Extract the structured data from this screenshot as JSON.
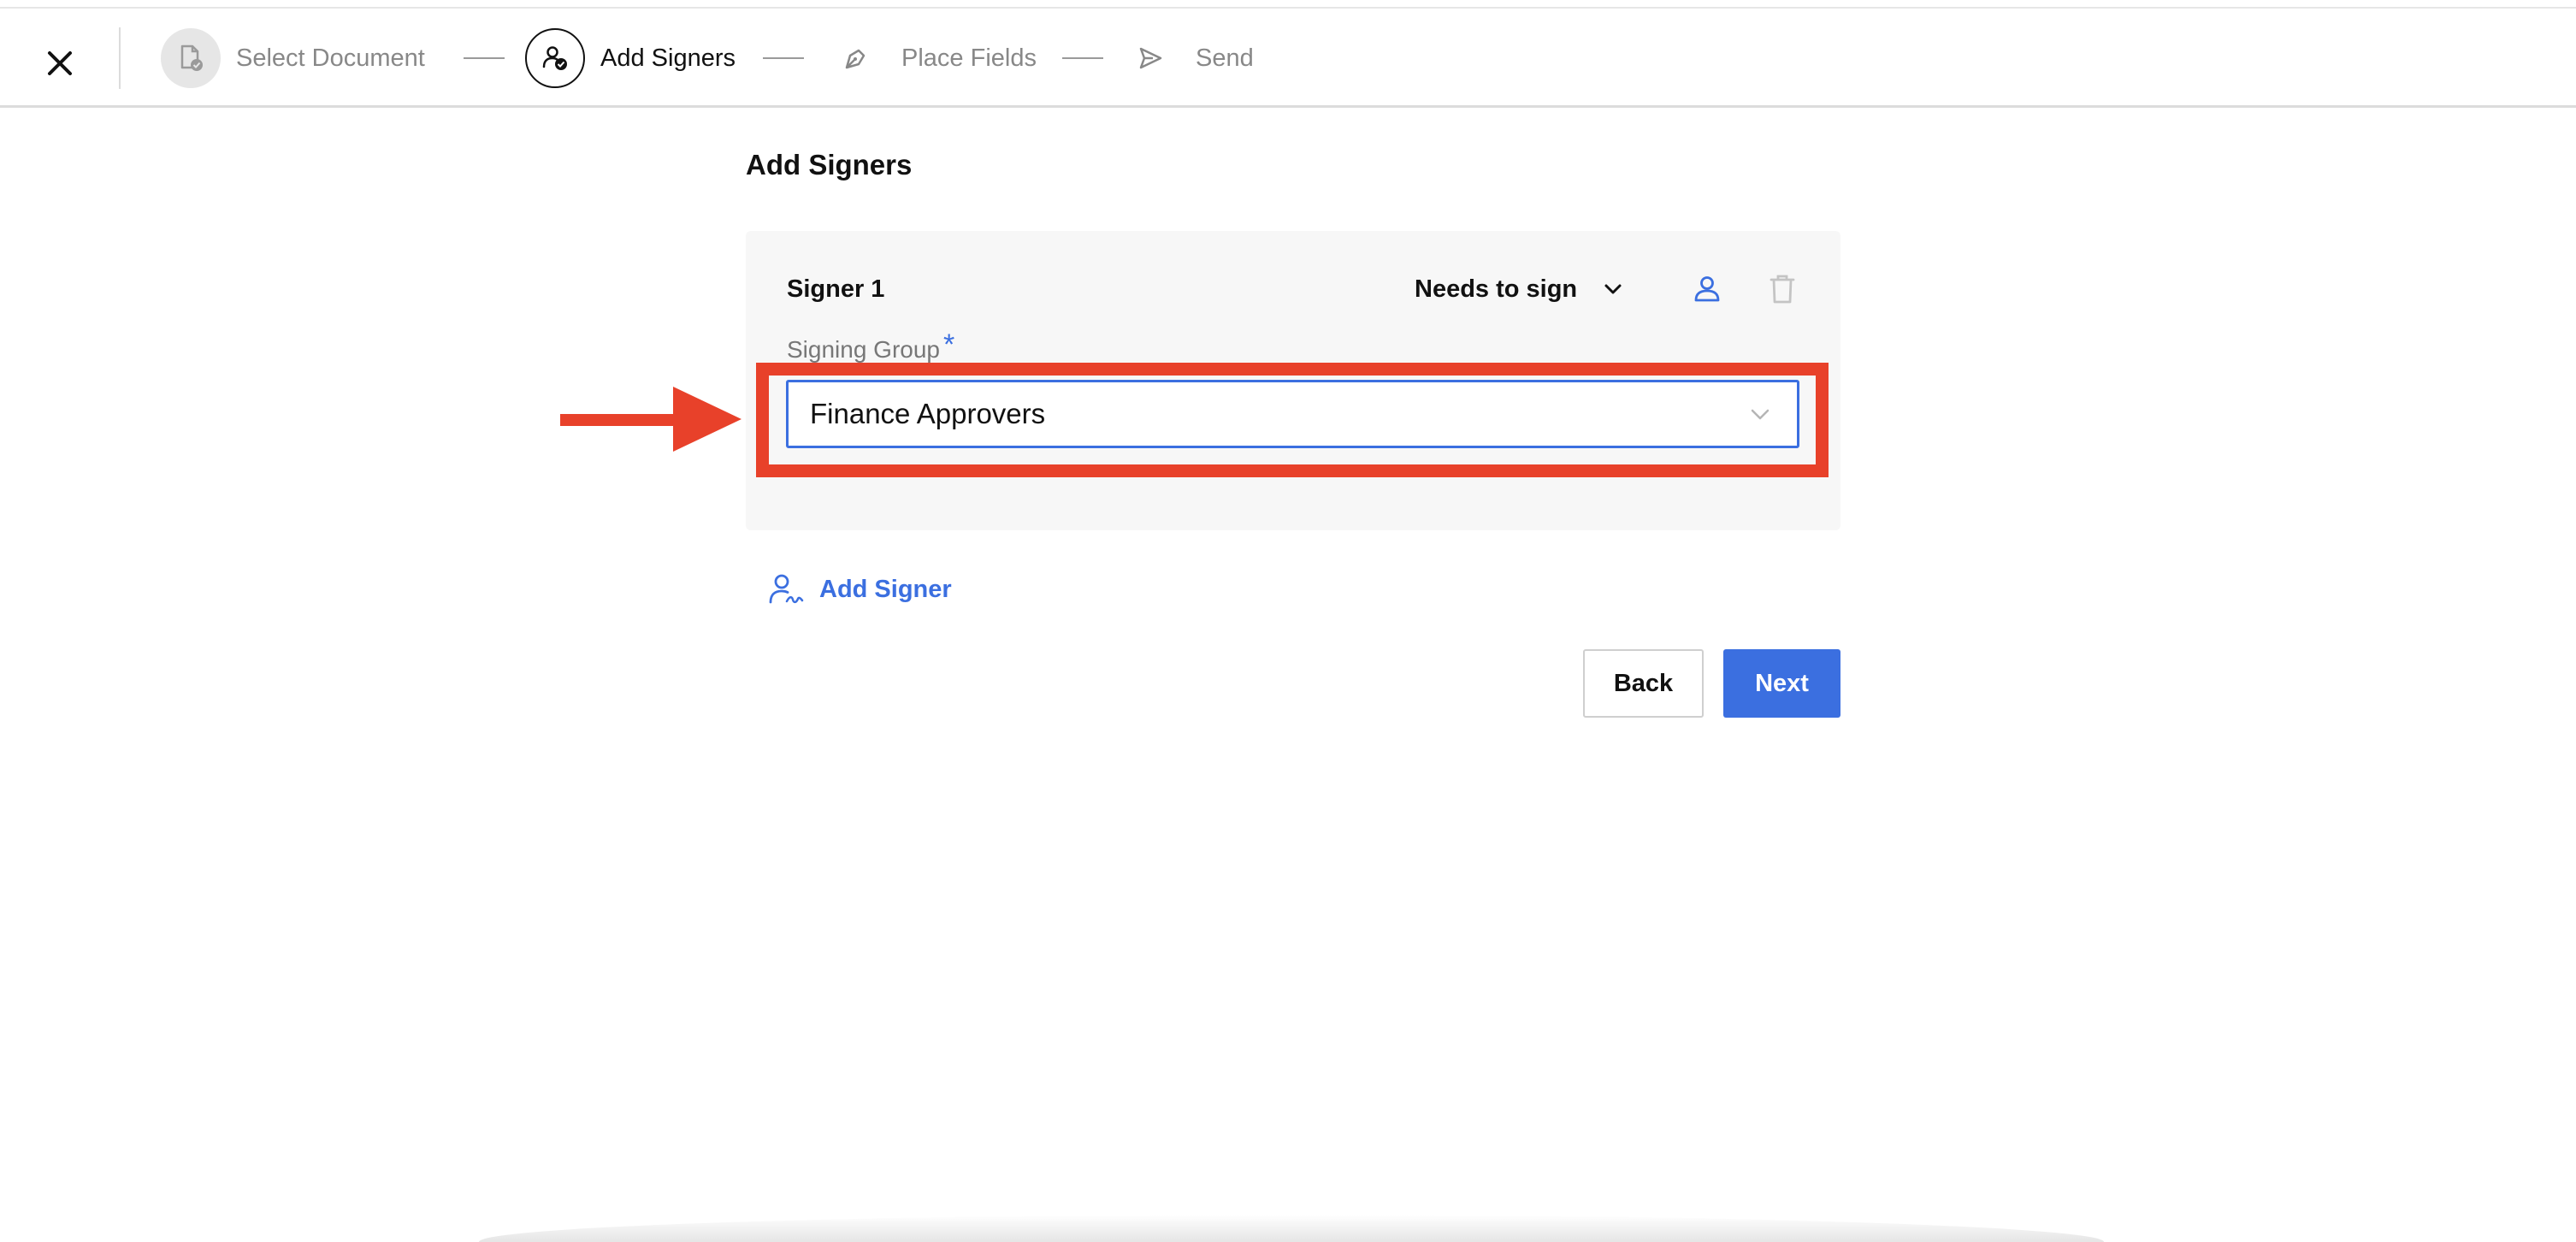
{
  "header": {
    "steps": [
      {
        "label": "Select Document",
        "icon": "document-check-icon",
        "state": "completed"
      },
      {
        "label": "Add Signers",
        "icon": "user-check-icon",
        "state": "active"
      },
      {
        "label": "Place Fields",
        "icon": "pen-nib-icon",
        "state": "upcoming"
      },
      {
        "label": "Send",
        "icon": "send-icon",
        "state": "upcoming"
      }
    ]
  },
  "page": {
    "title": "Add Signers"
  },
  "signer": {
    "title": "Signer 1",
    "role": "Needs to sign",
    "field_label": "Signing Group",
    "required_mark": "*",
    "group_value": "Finance Approvers"
  },
  "actions": {
    "add_signer": "Add Signer",
    "back": "Back",
    "next": "Next"
  },
  "colors": {
    "accent": "#3b6fe0",
    "annotation": "#e8412a"
  }
}
